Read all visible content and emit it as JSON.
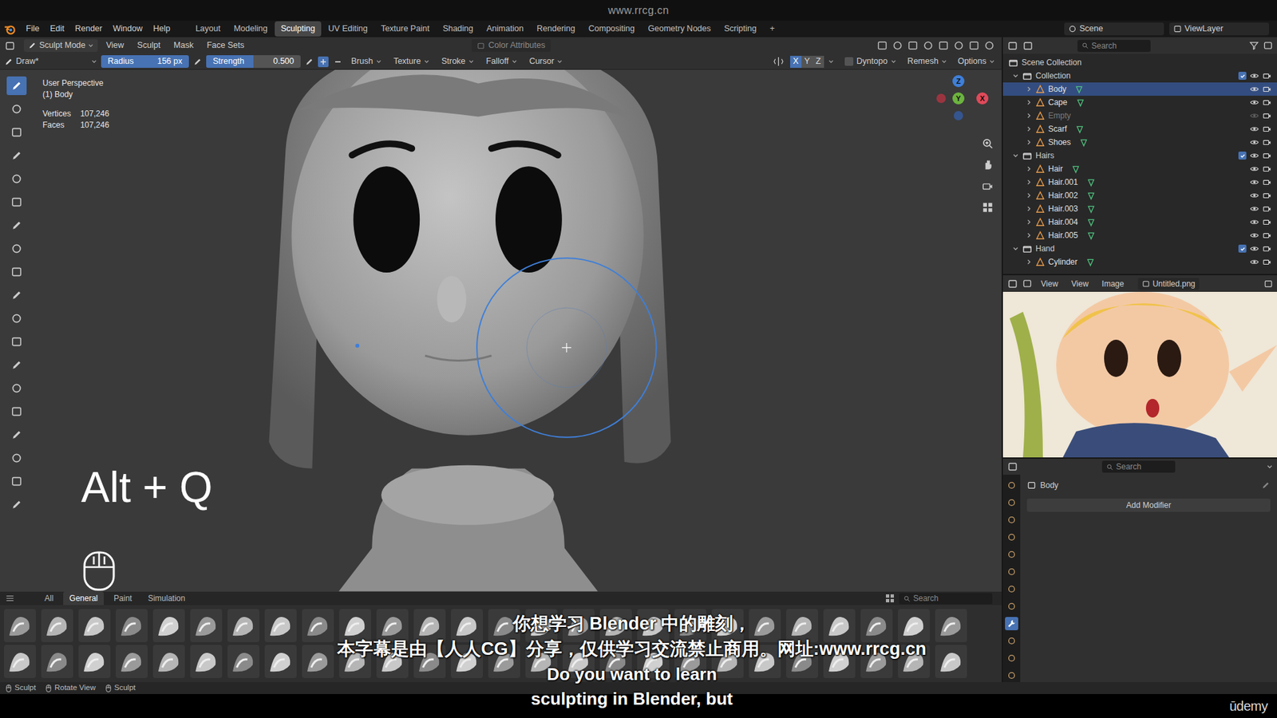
{
  "watermark": "www.rrcg.cn",
  "topbar": {
    "menus": [
      "File",
      "Edit",
      "Render",
      "Window",
      "Help"
    ],
    "workspaces": [
      {
        "label": "Layout",
        "selected": false
      },
      {
        "label": "Modeling",
        "selected": false
      },
      {
        "label": "Sculpting",
        "selected": true
      },
      {
        "label": "UV Editing",
        "selected": false
      },
      {
        "label": "Texture Paint",
        "selected": false
      },
      {
        "label": "Shading",
        "selected": false
      },
      {
        "label": "Animation",
        "selected": false
      },
      {
        "label": "Rendering",
        "selected": false
      },
      {
        "label": "Compositing",
        "selected": false
      },
      {
        "label": "Geometry Nodes",
        "selected": false
      },
      {
        "label": "Scripting",
        "selected": false
      },
      {
        "label": "+",
        "selected": false
      }
    ],
    "scene": "Scene",
    "view_layer": "ViewLayer"
  },
  "header": {
    "mode": "Sculpt Mode",
    "menus": [
      "View",
      "Sculpt",
      "Mask",
      "Face Sets"
    ],
    "color_attributes": "Color Attributes"
  },
  "tool_settings": {
    "brush_name": "Draw*",
    "radius_label": "Radius",
    "radius": "156 px",
    "strength_label": "Strength",
    "strength": "0.500",
    "strength_level": 0.5,
    "dropdowns": [
      "Brush",
      "Texture",
      "Stroke",
      "Falloff",
      "Cursor"
    ],
    "axes": [
      {
        "label": "X",
        "selected": true
      },
      {
        "label": "Y",
        "selected": false
      },
      {
        "label": "Z",
        "selected": false
      }
    ],
    "dyntopo": "Dyntopo",
    "dyntopo_checked": false,
    "remesh": "Remesh",
    "options": "Options"
  },
  "viewport": {
    "perspective": "User Perspective",
    "object": "(1) Body",
    "stats": [
      {
        "label": "Vertices",
        "value": "107,246"
      },
      {
        "label": "Faces",
        "value": "107,246"
      }
    ],
    "gizmo": [
      "X",
      "Y",
      "Z"
    ],
    "shortcut_overlay": "Alt + Q"
  },
  "outliner": {
    "search": "Search",
    "root": "Scene Collection",
    "collections": [
      {
        "label": "Collection",
        "checked": true,
        "expanded": true,
        "objects": [
          {
            "label": "Body",
            "selected": true,
            "hidden": false
          },
          {
            "label": "Cape",
            "selected": false,
            "hidden": false
          },
          {
            "label": "Empty",
            "selected": false,
            "hidden": true
          },
          {
            "label": "Scarf",
            "selected": false,
            "hidden": false
          },
          {
            "label": "Shoes",
            "selected": false,
            "hidden": false
          }
        ]
      },
      {
        "label": "Hairs",
        "checked": true,
        "expanded": true,
        "objects": [
          {
            "label": "Hair",
            "selected": false,
            "hidden": false
          },
          {
            "label": "Hair.001",
            "selected": false,
            "hidden": false
          },
          {
            "label": "Hair.002",
            "selected": false,
            "hidden": false
          },
          {
            "label": "Hair.003",
            "selected": false,
            "hidden": false
          },
          {
            "label": "Hair.004",
            "selected": false,
            "hidden": false
          },
          {
            "label": "Hair.005",
            "selected": false,
            "hidden": false
          }
        ]
      },
      {
        "label": "Hand",
        "checked": true,
        "expanded": true,
        "objects": [
          {
            "label": "Cylinder",
            "selected": false,
            "hidden": false
          }
        ]
      }
    ]
  },
  "image_editor": {
    "menus": [
      "View",
      "View",
      "Image"
    ],
    "image": "Untitled.png"
  },
  "properties": {
    "search": "Search",
    "object": "Body",
    "add_modifier": "Add Modifier"
  },
  "asset_shelf": {
    "tabs": [
      {
        "label": "All",
        "selected": false
      },
      {
        "label": "General",
        "selected": true
      },
      {
        "label": "Paint",
        "selected": false
      },
      {
        "label": "Simulation",
        "selected": false
      }
    ],
    "search": "Search"
  },
  "status_bar": [
    "Sculpt",
    "Rotate View",
    "Sculpt"
  ],
  "subtitles": {
    "zh": [
      "你想学习 Blender 中的雕刻，",
      "本字幕是由【人人CG】分享，仅供学习交流禁止商用。网址:www.rrcg.cn"
    ],
    "en": [
      "Do you want to learn",
      "sculpting in Blender, but"
    ]
  },
  "brand": "ūdemy"
}
